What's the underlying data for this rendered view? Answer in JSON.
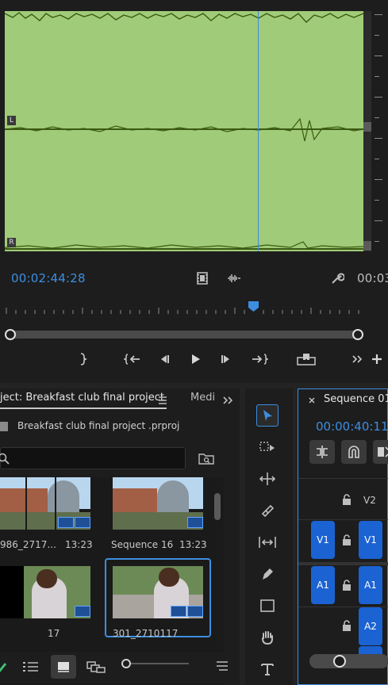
{
  "source_monitor": {
    "channels": [
      "L",
      "R"
    ],
    "timecode_in": "00:02:44:28",
    "timecode_duration": "00:03",
    "playhead_position": 0.705
  },
  "project_panel": {
    "tab_title": "ject: Breakfast club final project",
    "tab_next": "Medi",
    "file_name": "Breakfast club final project .prproj",
    "search_placeholder": "",
    "items": [
      {
        "name": "986_2717...",
        "duration": "13:23"
      },
      {
        "name": "Sequence 16",
        "duration": "13:23"
      },
      {
        "name": "",
        "duration": "17"
      },
      {
        "name": "301_2710117",
        "duration": ""
      }
    ]
  },
  "sequence_panel": {
    "tab_title": "Sequence 01",
    "timecode": "00:00:40:11",
    "tracks": {
      "video_source": "V1",
      "video_target": "V1",
      "video_upper": "V2",
      "audio_source": "A1",
      "audio_target": "A1",
      "audio_second": "A2"
    }
  },
  "colors": {
    "accent_blue": "#3d8ee0",
    "waveform_bg": "#a0cb78",
    "track_button": "#1b62d3"
  }
}
